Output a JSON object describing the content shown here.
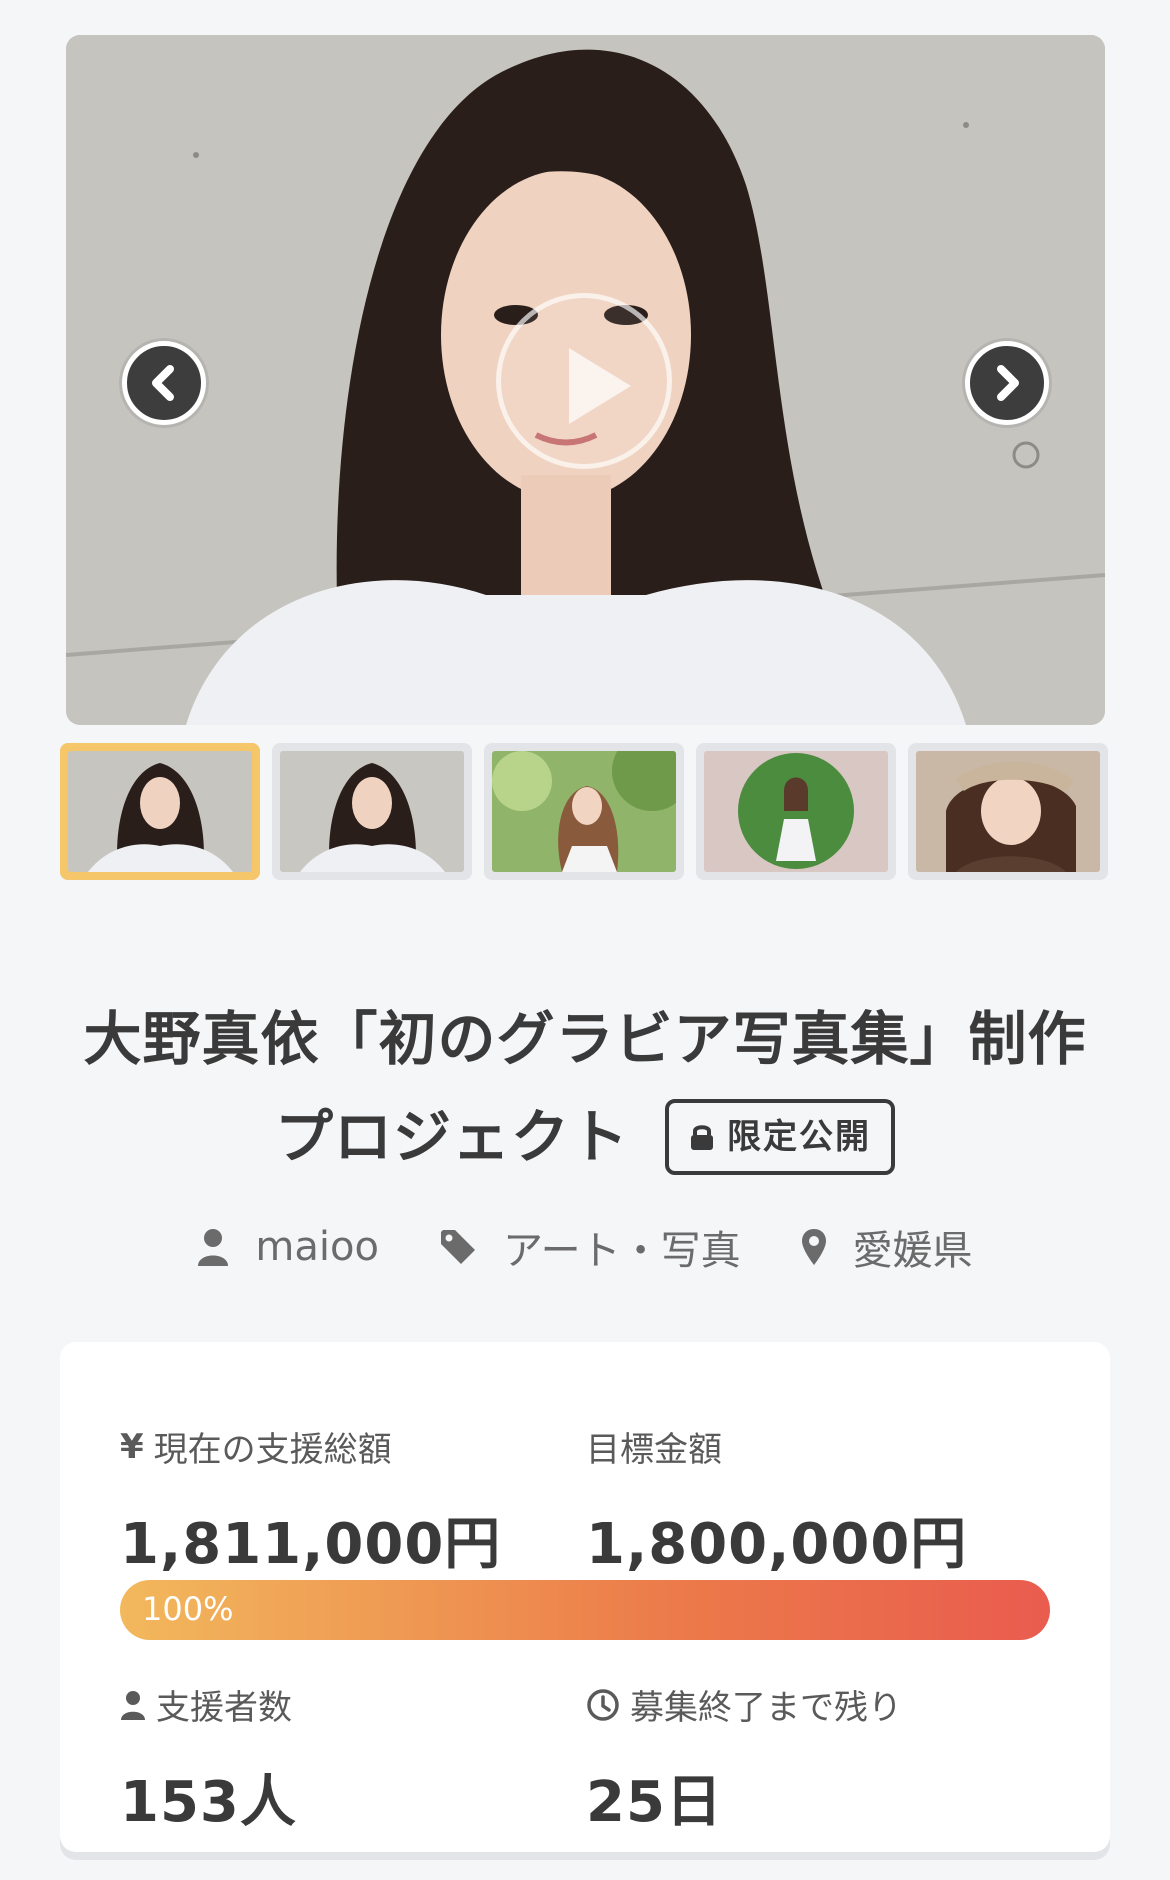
{
  "gallery": {
    "main_image": "project-hero-photo",
    "thumbnail_count": 5,
    "active_thumbnail": 1
  },
  "project": {
    "title_line1": "大野真依「初のグラビア写真集」制作",
    "title_line2": "プロジェクト",
    "badge_label": "限定公開"
  },
  "meta": {
    "author": "maioo",
    "category": "アート・写真",
    "location": "愛媛県"
  },
  "stats": {
    "current_label": "現在の支援総額",
    "current_icon_text": "¥",
    "current_value": "1,811,000円",
    "goal_label": "目標金額",
    "goal_value": "1,800,000円",
    "progress_text": "100%",
    "progress_fraction": 1.0,
    "supporters_label": "支援者数",
    "supporters_value": "153人",
    "remaining_label": "募集終了まで残り",
    "remaining_value": "25日"
  },
  "colors": {
    "background": "#f5f6f8",
    "active_thumb_border": "#f5c66a",
    "progress_start": "#f2b85c",
    "progress_end": "#e95c4e",
    "text": "#3a3a3a"
  }
}
